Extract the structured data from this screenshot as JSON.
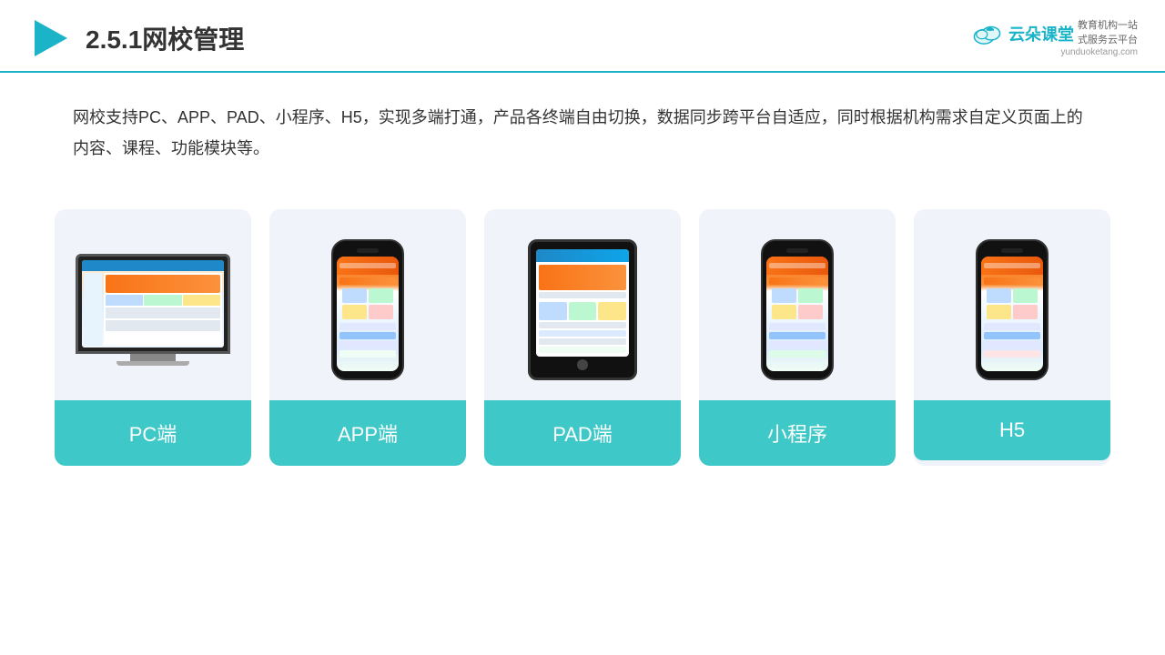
{
  "header": {
    "title": "2.5.1网校管理",
    "brand": {
      "name": "云朵课堂",
      "url": "yunduoketang.com",
      "tagline": "教育机构一站\n式服务云平台"
    }
  },
  "description": {
    "text": "网校支持PC、APP、PAD、小程序、H5，实现多端打通，产品各终端自由切换，数据同步跨平台自适应，同时根据机构需求自定义页面上的内容、课程、功能模块等。"
  },
  "cards": [
    {
      "id": "pc",
      "label": "PC端"
    },
    {
      "id": "app",
      "label": "APP端"
    },
    {
      "id": "pad",
      "label": "PAD端"
    },
    {
      "id": "miniapp",
      "label": "小程序"
    },
    {
      "id": "h5",
      "label": "H5"
    }
  ]
}
